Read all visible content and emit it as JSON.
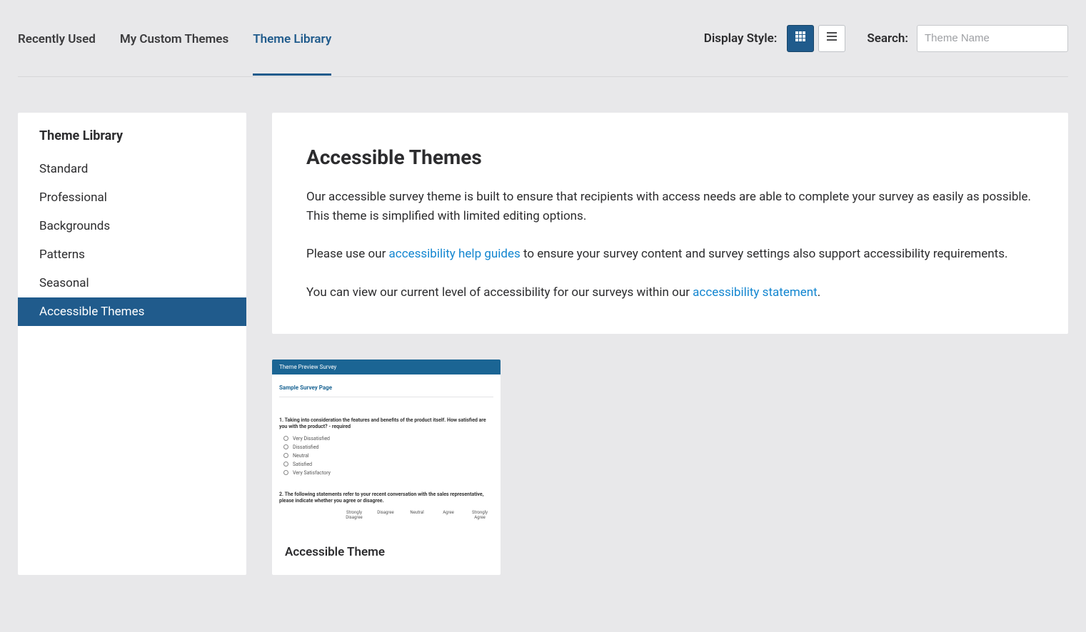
{
  "tabs": [
    {
      "label": "Recently Used"
    },
    {
      "label": "My Custom Themes"
    },
    {
      "label": "Theme Library"
    }
  ],
  "display_style_label": "Display Style:",
  "search": {
    "label": "Search:",
    "placeholder": "Theme Name"
  },
  "sidebar": {
    "title": "Theme Library",
    "items": [
      {
        "label": "Standard"
      },
      {
        "label": "Professional"
      },
      {
        "label": "Backgrounds"
      },
      {
        "label": "Patterns"
      },
      {
        "label": "Seasonal"
      },
      {
        "label": "Accessible Themes"
      }
    ]
  },
  "info": {
    "title": "Accessible Themes",
    "p1": "Our accessible survey theme is built to ensure that recipients with access needs are able to complete your survey as easily as possible. This theme is simplified with limited editing options.",
    "p2_pre": "Please use our ",
    "p2_link": "accessibility help guides",
    "p2_post": " to ensure your survey content and survey settings also support accessibility requirements.",
    "p3_pre": "You can view our current level of accessibility for our surveys within our ",
    "p3_link": "accessibility statement",
    "p3_post": "."
  },
  "theme_card": {
    "title": "Accessible Theme",
    "preview": {
      "header": "Theme Preview Survey",
      "page_title": "Sample Survey Page",
      "q1": "1. Taking into consideration the features and benefits of the product itself. How satisfied are you with the product? - required",
      "opts": [
        "Very Dissatisfied",
        "Dissatisfied",
        "Neutral",
        "Satisfied",
        "Very Satisfactory"
      ],
      "q2": "2. The following statements refer to your recent conversation with the sales representative, please indicate whether you agree or disagree.",
      "scale": [
        "Strongly Disagree",
        "Disagree",
        "Neutral",
        "Agree",
        "Strongly Agree"
      ]
    }
  }
}
